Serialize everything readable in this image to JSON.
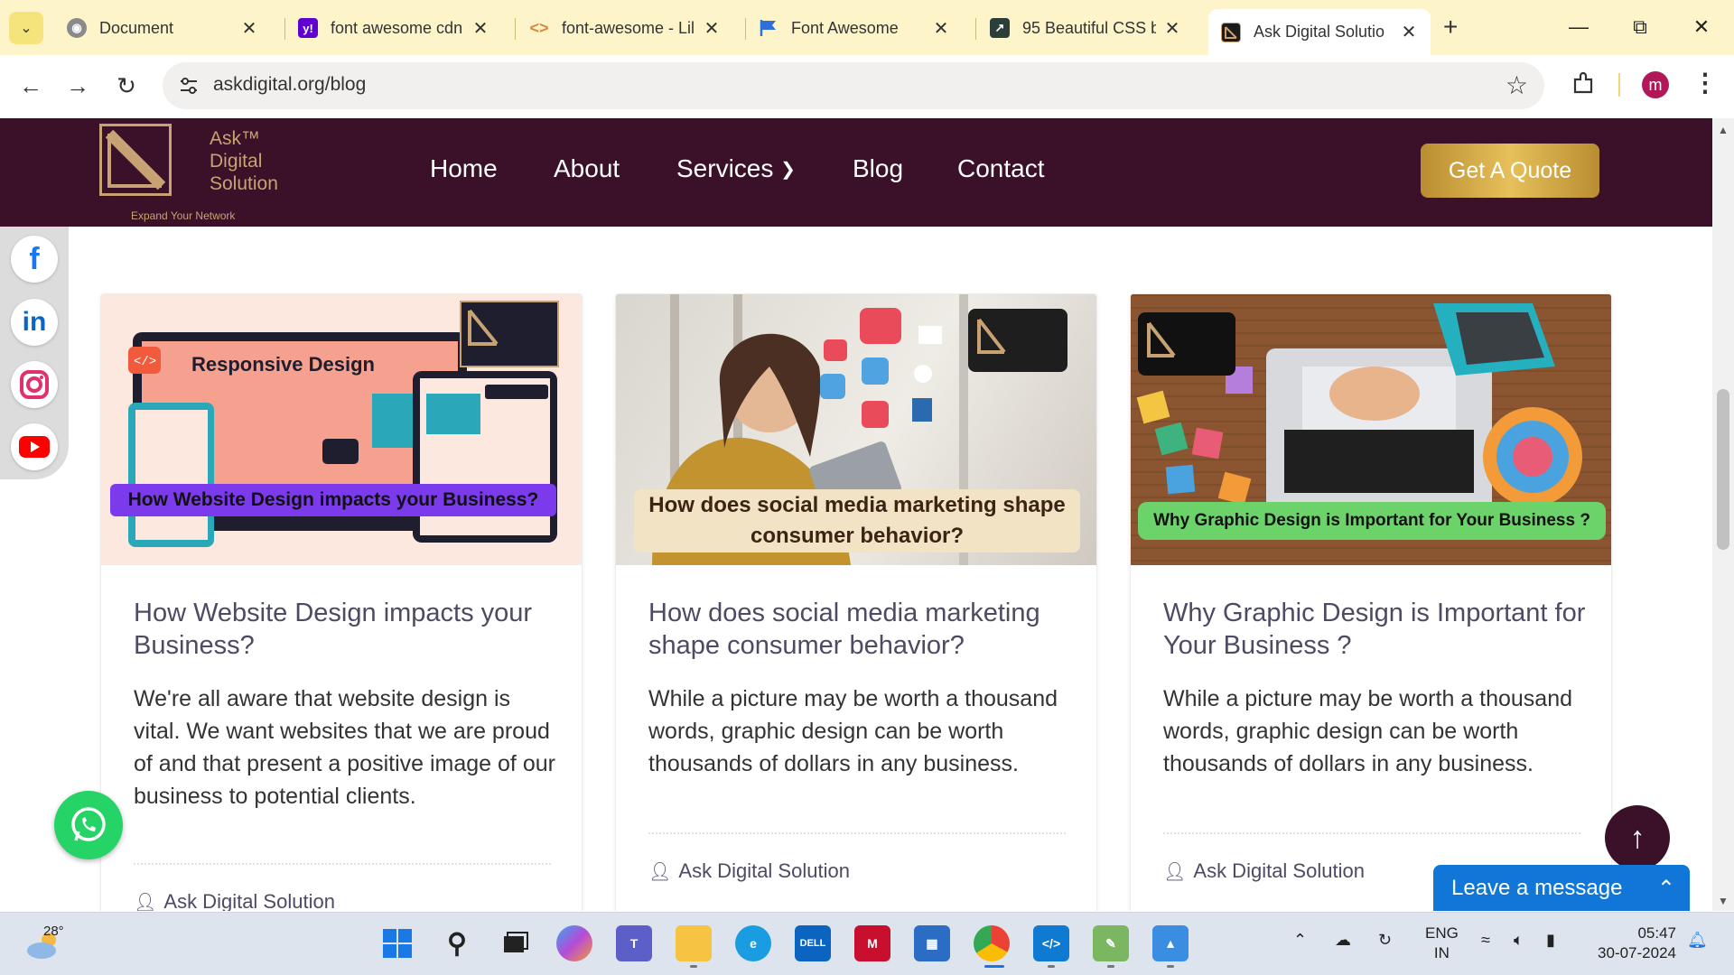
{
  "browser": {
    "tabs": [
      {
        "title": "Document",
        "active": false
      },
      {
        "title": "font awesome cdn",
        "active": false
      },
      {
        "title": "font-awesome - Lil",
        "active": false
      },
      {
        "title": "Font Awesome",
        "active": false
      },
      {
        "title": "95 Beautiful CSS b",
        "active": false
      },
      {
        "title": "Ask Digital Solutio",
        "active": true
      }
    ],
    "url": "askdigital.org/blog",
    "profile_initial": "m"
  },
  "site": {
    "logo_lines": [
      "Ask™",
      "Digital",
      "Solution"
    ],
    "tagline": "Expand Your Network",
    "nav": [
      "Home",
      "About",
      "Services",
      "Blog",
      "Contact"
    ],
    "quote_button": "Get A Quote"
  },
  "social": [
    "facebook",
    "linkedin",
    "instagram",
    "youtube"
  ],
  "posts": [
    {
      "image_caption": "How Website Design impacts your Business?",
      "image_heading": "Responsive Design",
      "title": "How Website Design impacts your Business?",
      "excerpt": "We're all aware that website design is vital. We want websites that we are proud of and that present a positive image of our business to potential clients.",
      "author": "Ask Digital Solution"
    },
    {
      "image_caption": "How does social media marketing shape consumer behavior?",
      "title": "How does social media marketing shape consumer behavior?",
      "excerpt": "While a picture may be worth a thousand words, graphic design can be worth thousands of dollars in any business.",
      "author": "Ask Digital Solution"
    },
    {
      "image_caption": "Why Graphic Design is Important for Your Business ?",
      "title": "Why Graphic Design is Important for Your Business ?",
      "excerpt": "While a picture may be worth a thousand words, graphic design can be worth thousands of dollars in any business.",
      "author": "Ask Digital Solution"
    }
  ],
  "chat": {
    "leave_message": "Leave a message"
  },
  "taskbar": {
    "temperature": "28°",
    "language": "ENG",
    "region": "IN",
    "time": "05:47",
    "date": "30-07-2024"
  },
  "colors": {
    "header_bg": "#3a1128",
    "gold": "#c9a273",
    "chat_blue": "#1076d8",
    "title_text": "#4e4a63"
  }
}
